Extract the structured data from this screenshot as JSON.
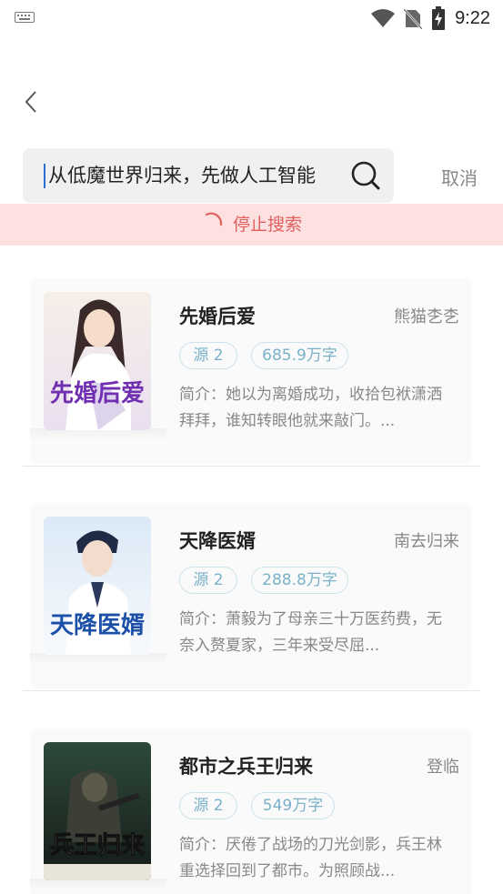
{
  "status_bar": {
    "time": "9:22"
  },
  "search": {
    "query": "从低魔世界归来，先做人工智能",
    "cancel_label": "取消"
  },
  "stop_bar": {
    "label": "停止搜索"
  },
  "results": [
    {
      "title": "先婚后爱",
      "author": "熊猫朰朰",
      "source": "源 2",
      "word_count": "685.9万字",
      "intro": "简介：她以为离婚成功，收拾包袱潇洒拜拜，谁知转眼他就来敲门。...",
      "cover_text": "先婚后爱"
    },
    {
      "title": "天降医婿",
      "author": "南去归来",
      "source": "源 2",
      "word_count": "288.8万字",
      "intro": "简介：萧毅为了母亲三十万医药费，无奈入赘夏家，三年来受尽屈...",
      "cover_text": "天降医婿"
    },
    {
      "title": "都市之兵王归来",
      "author": "登临",
      "source": "源 2",
      "word_count": "549万字",
      "intro": "简介：厌倦了战场的刀光剑影，兵王林重选择回到了都市。为照顾战...",
      "cover_text": "兵王归来"
    }
  ]
}
